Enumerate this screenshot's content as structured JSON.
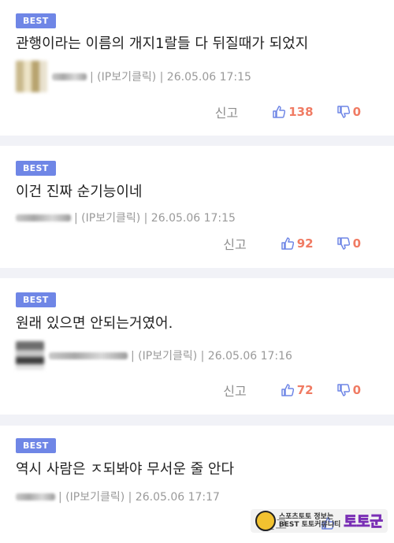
{
  "badge_label": "BEST",
  "report_label": "신고",
  "comments": [
    {
      "text": "관행이라는 이름의 개지1랄들 다 뒤질때가 되었지",
      "author_suffix": "| (IP보기클릭) | 26.05.06 17:15",
      "likes": "138",
      "dislikes": "0"
    },
    {
      "text": "이건 진짜 순기능이네",
      "author_suffix": "| (IP보기클릭) | 26.05.06 17:15",
      "likes": "92",
      "dislikes": "0"
    },
    {
      "text": "원래 있으면 안되는거였어.",
      "author_suffix": "| (IP보기클릭) | 26.05.06 17:16",
      "likes": "72",
      "dislikes": "0"
    },
    {
      "text": "역시 사람은 ㅈ되봐야 무서운 줄 안다",
      "author_suffix": "| (IP보기클릭) | 26.05.06 17:17",
      "likes": "",
      "dislikes": ""
    }
  ],
  "watermark": {
    "line1": "스포츠토토 정보는",
    "line2": "BEST 토토커뮤니티",
    "brand": "토토군"
  },
  "colors": {
    "badge": "#6f86e6",
    "vote_count": "#f07b63",
    "vote_icon": "#6f86e6"
  }
}
